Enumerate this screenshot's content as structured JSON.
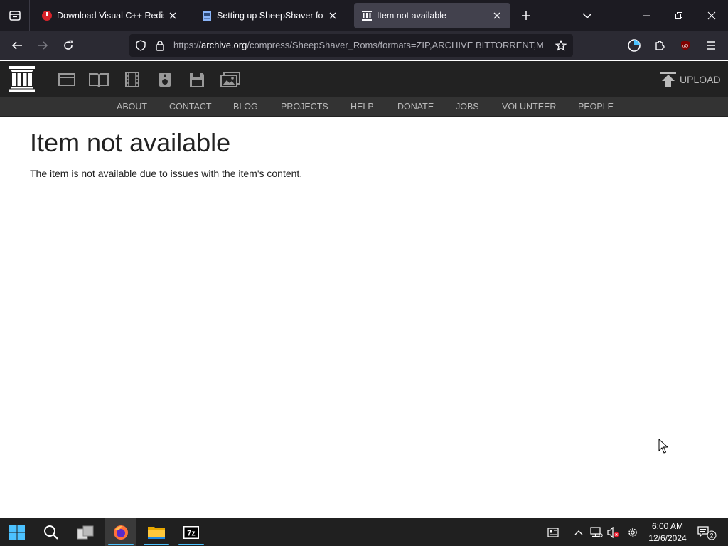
{
  "browser": {
    "tabs": [
      {
        "title": "Download Visual C++ Redistrib",
        "icon": "opera-red-icon"
      },
      {
        "title": "Setting up SheepShaver for Win",
        "icon": "document-page-icon"
      },
      {
        "title": "Item not available",
        "icon": "archive-pillars-icon",
        "active": true
      }
    ],
    "url_prefix": "https://",
    "url_host": "archive.org",
    "url_path": "/compress/SheepShaver_Roms/formats=ZIP,ARCHIVE BITTORRENT,M"
  },
  "ia": {
    "media_icons": [
      "web-icon",
      "texts-icon",
      "video-icon",
      "audio-icon",
      "software-icon",
      "images-icon"
    ],
    "upload_label": "UPLOAD",
    "nav": [
      "ABOUT",
      "CONTACT",
      "BLOG",
      "PROJECTS",
      "HELP",
      "DONATE",
      "JOBS",
      "VOLUNTEER",
      "PEOPLE"
    ]
  },
  "content": {
    "title": "Item not available",
    "message": "The item is not available due to issues with the item's content."
  },
  "taskbar": {
    "time": "6:00 AM",
    "date": "12/6/2024",
    "notification_count": "2",
    "apps": [
      "start-icon",
      "search-icon",
      "task-view-icon",
      "firefox-icon",
      "file-explorer-icon",
      "7zip-icon"
    ]
  },
  "colors": {
    "tabbar_bg": "#1c1b22",
    "navbar_bg": "#2b2a33",
    "ia_header_bg": "#222222",
    "ia_nav_bg": "#333333",
    "taskbar_bg": "#202020",
    "accent": "#4cc2ff"
  }
}
